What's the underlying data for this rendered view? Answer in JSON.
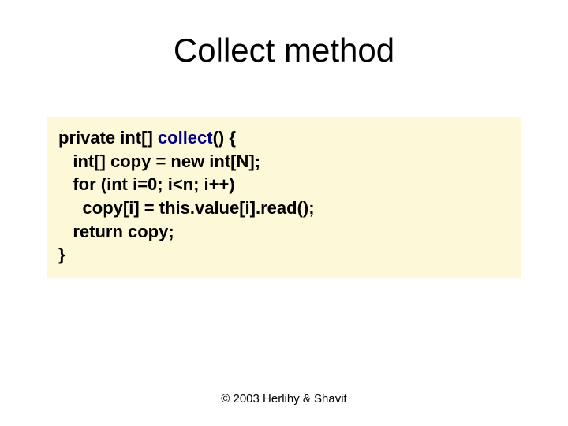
{
  "title": "Collect method",
  "code": {
    "l1a": "private int[] ",
    "l1b": "collect",
    "l1c": "() {",
    "l2": "   int[] copy = new int[N];",
    "l3": "   for (int i=0; i<n; i++)",
    "l4": "     copy[i] = this.value[i].read();",
    "l5": "   return copy;",
    "l6": "}"
  },
  "footer": "© 2003 Herlihy & Shavit"
}
